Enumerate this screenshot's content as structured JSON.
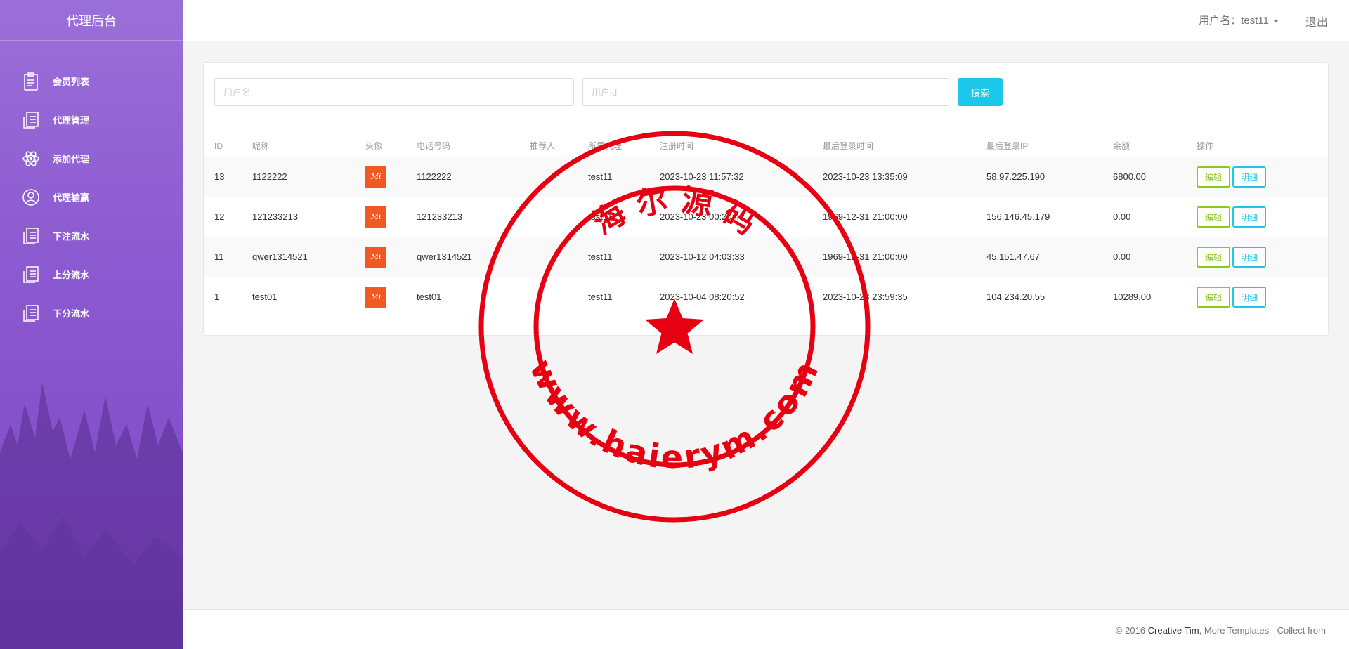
{
  "sidebar": {
    "brand": "代理后台",
    "items": [
      {
        "label": "会员列表",
        "icon": "clipboard-icon"
      },
      {
        "label": "代理管理",
        "icon": "document-list-icon"
      },
      {
        "label": "添加代理",
        "icon": "atom-icon"
      },
      {
        "label": "代理输赢",
        "icon": "user-circle-icon"
      },
      {
        "label": "下注流水",
        "icon": "document-list-icon"
      },
      {
        "label": "上分流水",
        "icon": "document-list-icon"
      },
      {
        "label": "下分流水",
        "icon": "document-list-icon"
      }
    ]
  },
  "topbar": {
    "user_label": "用户名：test11",
    "logout_label": "退出"
  },
  "search": {
    "username_placeholder": "用户名",
    "userid_placeholder": "用户id",
    "button_label": "搜索"
  },
  "table": {
    "headers": [
      "ID",
      "昵称",
      "头像",
      "电话号码",
      "推荐人",
      "所属代理",
      "注册时间",
      "最后登录时间",
      "最后登录IP",
      "余额",
      "操作"
    ],
    "edit_label": "编辑",
    "detail_label": "明细",
    "avatar_text": "Mi",
    "rows": [
      {
        "id": "13",
        "nick": "1122222",
        "phone": "1122222",
        "ref": "",
        "agent": "test11",
        "reg": "2023-10-23 11:57:32",
        "login": "2023-10-23 13:35:09",
        "ip": "58.97.225.190",
        "balance": "6800.00"
      },
      {
        "id": "12",
        "nick": "121233213",
        "phone": "121233213",
        "ref": "",
        "agent": "test11",
        "reg": "2023-10-23 00:20:42",
        "login": "1969-12-31 21:00:00",
        "ip": "156.146.45.179",
        "balance": "0.00"
      },
      {
        "id": "11",
        "nick": "qwer1314521",
        "phone": "qwer1314521",
        "ref": "",
        "agent": "test11",
        "reg": "2023-10-12 04:03:33",
        "login": "1969-12-31 21:00:00",
        "ip": "45.151.47.67",
        "balance": "0.00"
      },
      {
        "id": "1",
        "nick": "test01",
        "phone": "test01",
        "ref": "",
        "agent": "test11",
        "reg": "2023-10-04 08:20:52",
        "login": "2023-10-23 23:59:35",
        "ip": "104.234.20.55",
        "balance": "10289.00"
      }
    ]
  },
  "footer": {
    "prefix": "© 2016 ",
    "brand": "Creative Tim",
    "suffix": ", More Templates - Collect from"
  },
  "watermark": {
    "top_text": "海 尔 源 码",
    "bottom_text": "www.haierym.com",
    "color": "#e60012"
  },
  "colors": {
    "accent": "#1dc7ea",
    "success": "#87cb16",
    "sidebar_top": "#9b6fd8",
    "sidebar_bottom": "#7e46c4"
  }
}
